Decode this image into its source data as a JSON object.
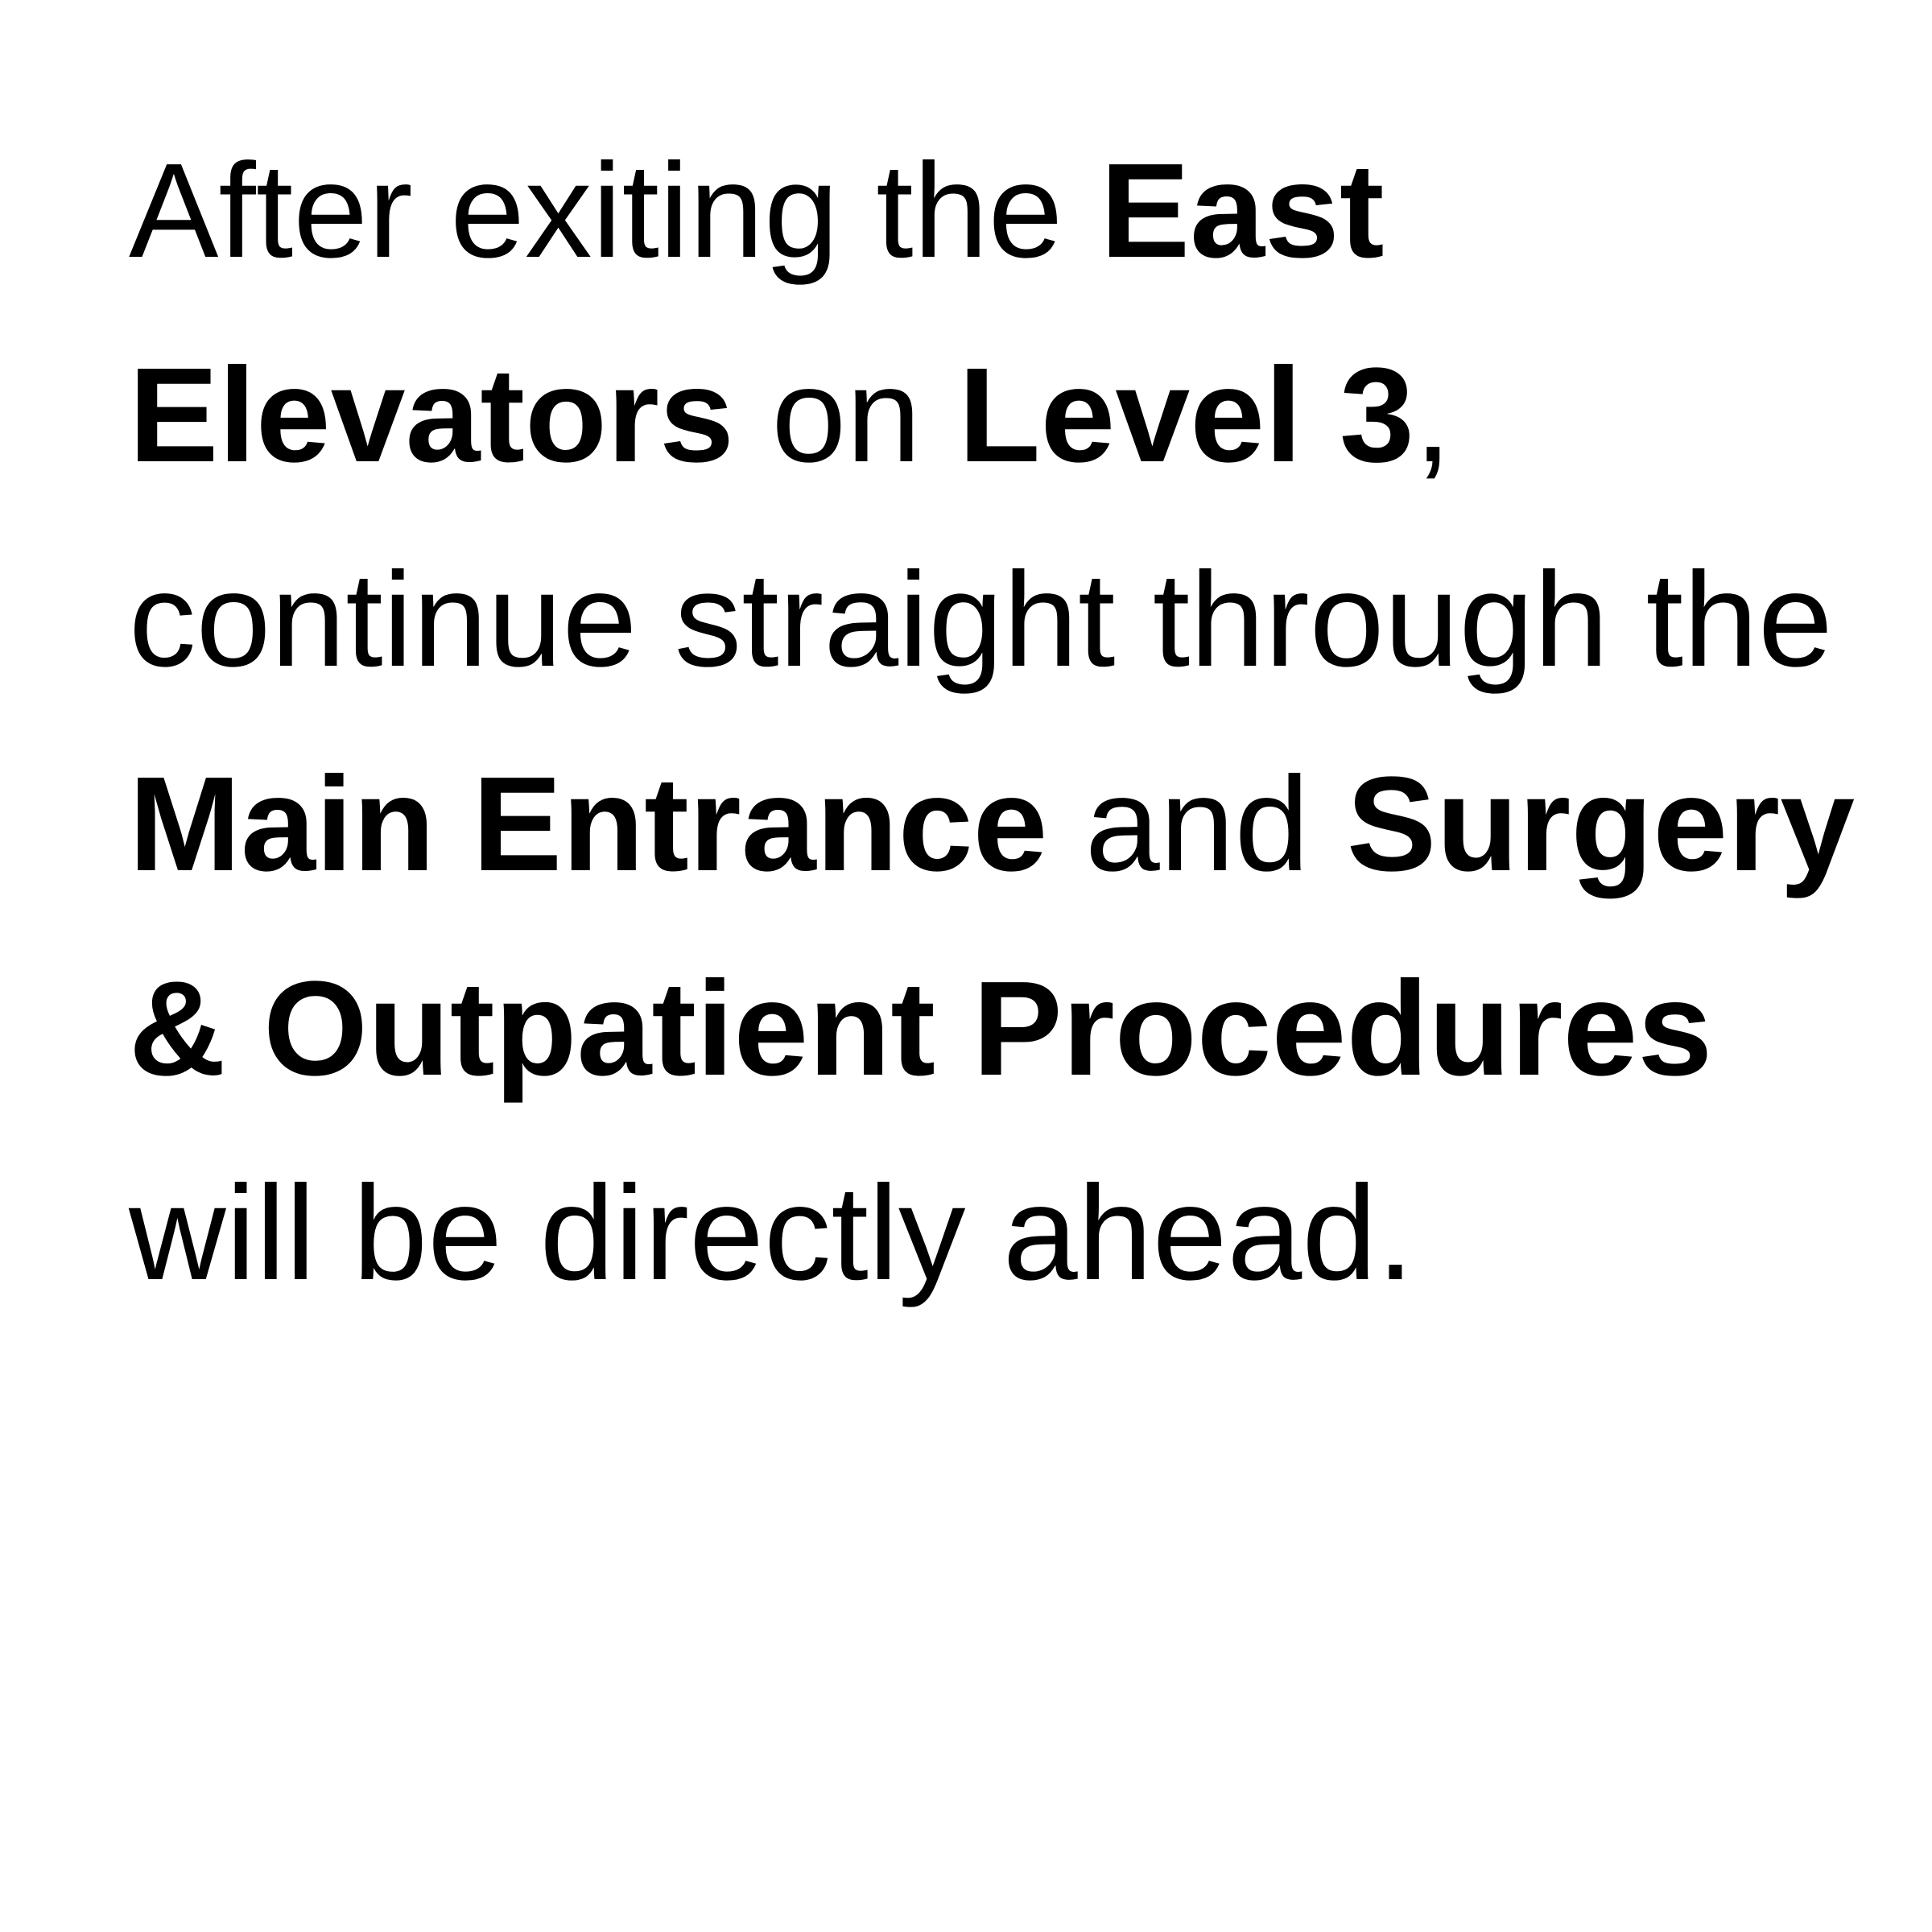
{
  "instruction": {
    "part1": "After exiting the ",
    "east_elevators": "East Elevators",
    "part2": " on ",
    "level": "Level 3",
    "part3": ", continue straight through the ",
    "main_entrance": "Main Entrance",
    "part4": " and ",
    "destination": "Surgery & Outpatient Procedures",
    "part5": " will be directly ahead."
  }
}
